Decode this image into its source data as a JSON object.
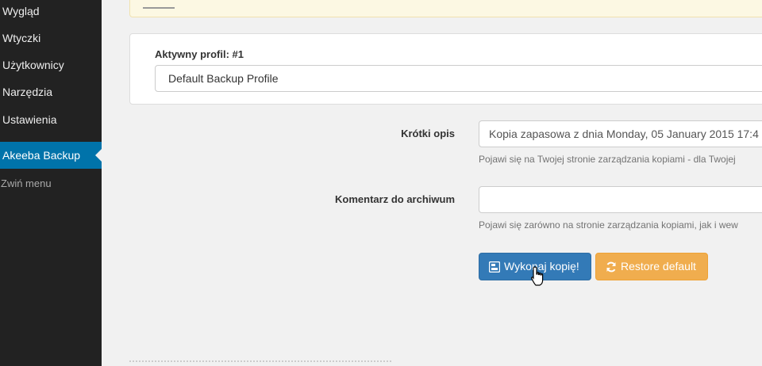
{
  "sidebar": {
    "items": [
      {
        "label": "Wygląd"
      },
      {
        "label": "Wtyczki"
      },
      {
        "label": "Użytkownicy"
      },
      {
        "label": "Narzędzia"
      },
      {
        "label": "Ustawienia"
      },
      {
        "label": "Akeeba Backup",
        "active": true
      }
    ],
    "collapse_label": "Zwiń menu"
  },
  "profile": {
    "label": "Aktywny profil: #1",
    "selected": "Default Backup Profile"
  },
  "form": {
    "description": {
      "label": "Krótki opis",
      "value": "Kopia zapasowa z dnia Monday, 05 January 2015 17:4",
      "help": "Pojawi się na Twojej stronie zarządzania kopiami - dla Twojej"
    },
    "comment": {
      "label": "Komentarz do archiwum",
      "value": "",
      "help": "Pojawi się zarówno na stronie zarządzania kopiami, jak i wew"
    }
  },
  "buttons": {
    "backup_label": "Wykonaj kopię!",
    "restore_label": "Restore default"
  },
  "colors": {
    "sidebar_bg": "#222222",
    "active_menu": "#0073aa",
    "primary": "#337ab7",
    "warning": "#f0ad4e"
  }
}
